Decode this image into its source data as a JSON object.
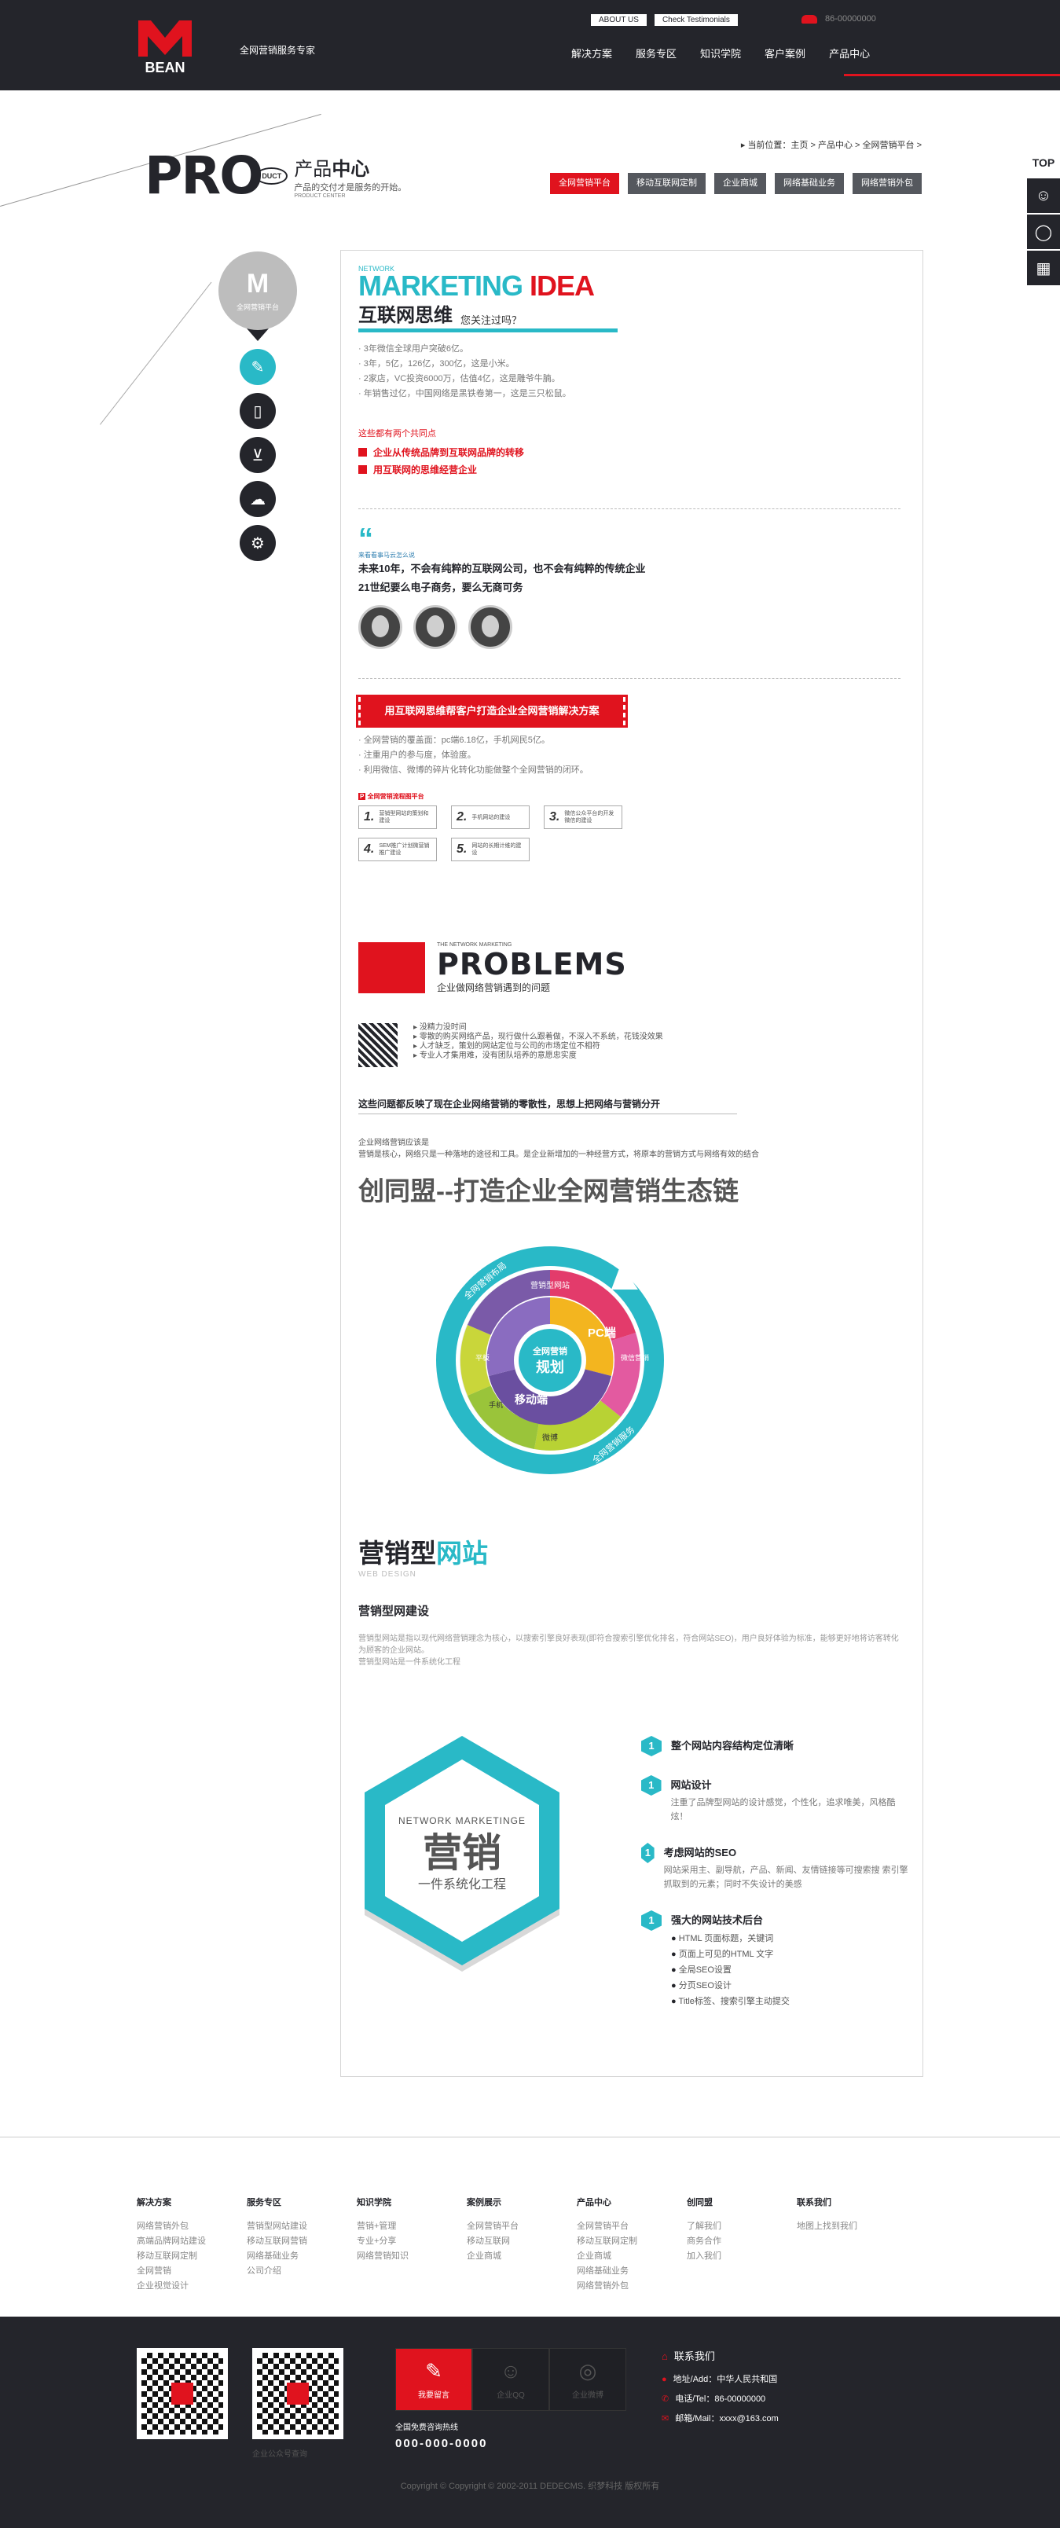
{
  "header": {
    "logo_text": "BEAN",
    "slogan": "全网营销服务专家",
    "top_links": [
      "ABOUT US",
      "Check Testimonials"
    ],
    "phone": "86-00000000",
    "nav": [
      "解决方案",
      "服务专区",
      "知识学院",
      "客户案例",
      "产品中心"
    ]
  },
  "banner": {
    "pro": "PRO",
    "duct": "DUCT",
    "title_a": "产品",
    "title_b": "中心",
    "tagline": "产品的交付才是服务的开始。",
    "en": "PRODUCT CENTER",
    "breadcrumb": "当前位置：主页 > 产品中心 > 全网营销平台 >",
    "categories": [
      "全网营销平台",
      "移动互联网定制",
      "企业商城",
      "网络基础业务",
      "网络营销外包"
    ]
  },
  "side": {
    "top": "TOP"
  },
  "leftcol": {
    "title": "全网营销平台"
  },
  "mi": {
    "network": "NETWORK",
    "marketing": "MARKETING",
    "idea": "IDEA",
    "heading": "互联网思维",
    "question": "您关注过吗？",
    "stats": [
      "3年微信全球用户突破6亿。",
      "3年，5亿，126亿，300亿，这是小米。",
      "2家店，VC投资6000万，估值4亿，这是雕爷牛腩。",
      "年销售过亿，中国网络是黑铁卷第一，这是三只松鼠。"
    ],
    "common": "这些都有两个共同点",
    "points": [
      "企业从传统品牌到互联网品牌的转移",
      "用互联网的思维经营企业"
    ]
  },
  "quote": {
    "mark": "“",
    "sub": "来看看事马云怎么说",
    "lines": [
      "未来10年，不会有纯粹的互联网公司，也不会有纯粹的传统企业",
      "21世纪要么电子商务，要么无商可务"
    ]
  },
  "solution": {
    "ribbon": "用互联网思维帮客户打造企业全网营销解决方案",
    "items": [
      "全网营销的覆盖面：pc端6.18亿，手机网民5亿。",
      "注重用户的参与度，体验度。",
      "利用微信、微博的碎片化转化功能做整个全网营销的闭环。"
    ],
    "mini_title": "全网营销流程图平台",
    "steps": [
      {
        "n": "1.",
        "t": "营销型网站的策划和建设"
      },
      {
        "n": "2.",
        "t": "手机网站的建设"
      },
      {
        "n": "3.",
        "t": "微信公众平台的开发微信的建设"
      },
      {
        "n": "4.",
        "t": "SEM推广计划微营销推广建设"
      },
      {
        "n": "5.",
        "t": "网站的长期计维的建设"
      }
    ]
  },
  "problems": {
    "small": "THE NETWORK MARKETING",
    "title": "PROBLEMS",
    "subtitle": "企业做网络营销遇到的问题",
    "list": [
      "没精力没时间",
      "零散的购买网络产品，现行做什么跟着做，不深入不系统，花钱没效果",
      "人才缺乏，策划的网站定位与公司的市场定位不相符",
      "专业人才集用难，没有团队培养的意愿忠实度"
    ],
    "conclusion": "这些问题都反映了现在企业网络营销的零散性，思想上把网络与营销分开",
    "p1": "企业网络营销应该是",
    "p2": "营销是核心，网络只是一种落地的途径和工具。是企业新增加的一种经营方式，将原本的营销方式与网络有效的结合",
    "slogan": "创同盟--打造企业全网营销生态链"
  },
  "wheel": {
    "center_a": "全网营销",
    "center_b": "规划",
    "pc": "PC端",
    "mobile": "移动端",
    "segs": [
      "营销型网站",
      "微信营销",
      "微博",
      "手机",
      "平板",
      "微信营销"
    ],
    "outer_a": "全网营销布局",
    "outer_b": "全网营销服务"
  },
  "web": {
    "title_a": "营销型",
    "title_b": "网站",
    "en": "WEB DESIGN",
    "sub": "营销型网建设",
    "desc": "营销型网站是指以现代网络营销理念为核心，以搜索引擎良好表现(即符合搜索引擎优化排名，符合网站SEO)，用户良好体验为标准，能够更好地将访客转化为顾客的企业网站。",
    "desc2": "营销型网站是一件系统化工程",
    "hex_en": "NETWORK MARKETINGE",
    "hex_cn": "营销",
    "hex_sub": "一件系统化工程",
    "features": [
      {
        "t": "整个网站内容结构定位清晰",
        "d": ""
      },
      {
        "t": "网站设计",
        "d": "注重了品牌型网站的设计感觉，个性化，追求唯美，风格酷炫！"
      },
      {
        "t": "考虑网站的SEO",
        "d": "网站采用主、副导航，产品、新闻、友情链接等可搜索搜 索引擎抓取到的元素；同时不失设计的美感"
      },
      {
        "t": "强大的网站技术后台",
        "d": ""
      }
    ],
    "tech": [
      "HTML 页面标题，关键词",
      "页面上可见的HTML 文字",
      "全局SEO设置",
      "分页SEO设计",
      "Title标签、搜索引擎主动提交"
    ]
  },
  "footer": {
    "cols": [
      {
        "h": "解决方案",
        "items": [
          "网络营销外包",
          "高端品牌网站建设",
          "移动互联网定制",
          "全网营销",
          "企业视觉设计"
        ]
      },
      {
        "h": "服务专区",
        "items": [
          "营销型网站建设",
          "移动互联网营销",
          "网络基础业务",
          "公司介绍"
        ]
      },
      {
        "h": "知识学院",
        "items": [
          "营销+管理",
          "专业+分享",
          "网络营销知识"
        ]
      },
      {
        "h": "案例展示",
        "items": [
          "全网营销平台",
          "移动互联网",
          "企业商城"
        ]
      },
      {
        "h": "产品中心",
        "items": [
          "全网营销平台",
          "移动互联网定制",
          "企业商城",
          "网络基础业务",
          "网络营销外包"
        ]
      },
      {
        "h": "创同盟",
        "items": [
          "了解我们",
          "商务合作",
          "加入我们"
        ]
      },
      {
        "h": "联系我们",
        "items": [
          "地图上找到我们"
        ]
      }
    ],
    "qr_labels": [
      "",
      "企业公众号查询"
    ],
    "svc": [
      "我要留言",
      "企业QQ",
      "企业微博"
    ],
    "hotline_label": "全国免费咨询热线",
    "hotline": "000-000-0000",
    "contact_title": "联系我们",
    "address": "地址/Add：中华人民共和国",
    "tel": "电话/Tel：86-00000000",
    "mail": "邮箱/Mail：xxxx@163.com",
    "copyright": "Copyright © Copyright © 2002-2011 DEDECMS. 织梦科技 版权所有"
  },
  "colors": {
    "red": "#e0131e",
    "teal": "#29b9c7",
    "dark": "#24252b"
  }
}
